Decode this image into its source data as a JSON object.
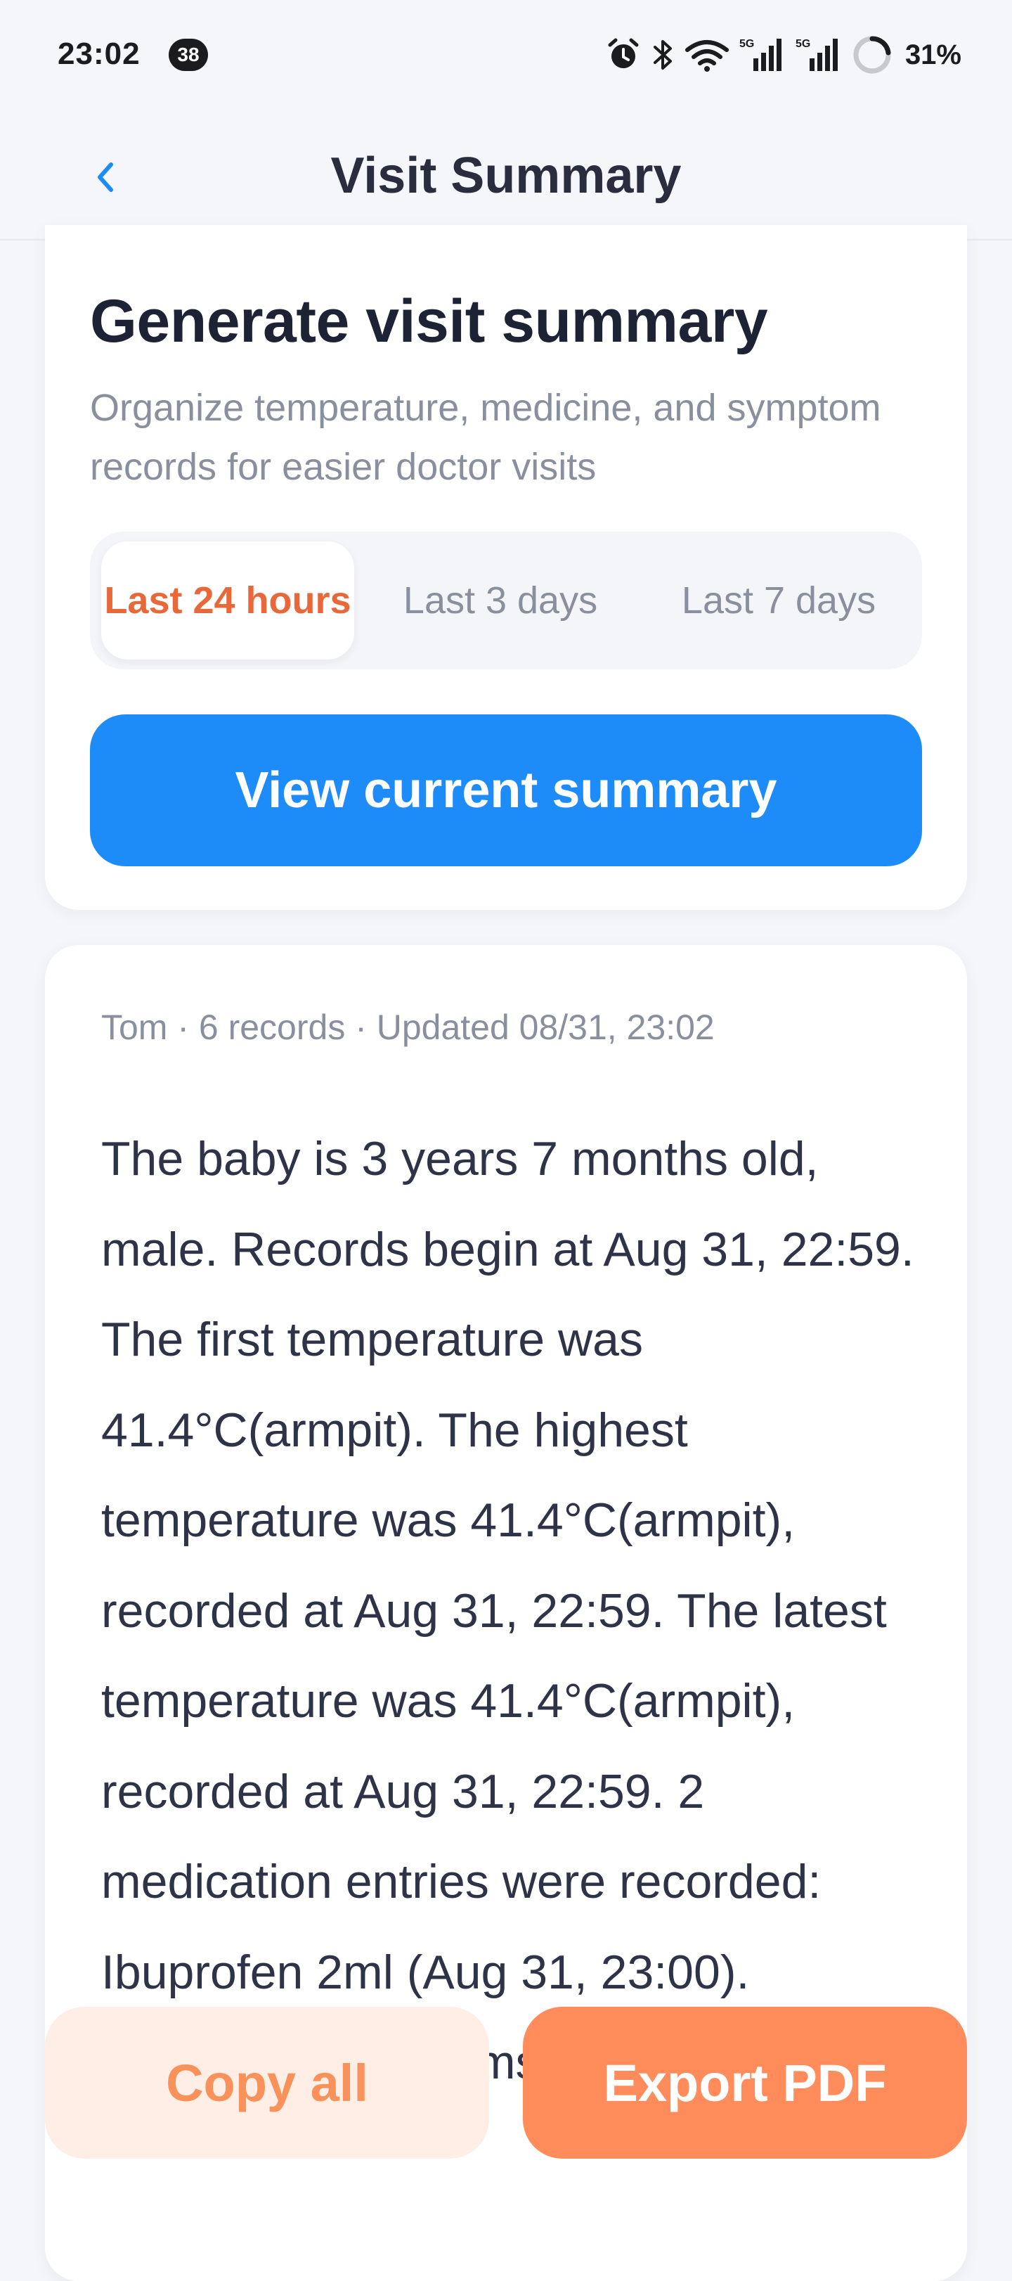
{
  "status_bar": {
    "time": "23:02",
    "notification_count": "38",
    "battery_percent": "31%",
    "icons": [
      "alarm-icon",
      "bluetooth-icon",
      "wifi-icon",
      "cellular-5g-icon",
      "cellular-5g-icon",
      "battery-ring-icon"
    ]
  },
  "header": {
    "title": "Visit Summary",
    "back_icon": "chevron-left-icon"
  },
  "generate": {
    "title": "Generate visit summary",
    "subtitle": "Organize temperature, medicine, and symptom records for easier doctor visits",
    "ranges": [
      {
        "label": "Last 24 hours",
        "selected": true
      },
      {
        "label": "Last 3 days",
        "selected": false
      },
      {
        "label": "Last 7 days",
        "selected": false
      }
    ],
    "view_button": "View current summary"
  },
  "summary": {
    "meta": "Tom · 6 records · Updated 08/31, 23:02",
    "text": "The baby is 3 years 7 months old, male. Records begin at Aug 31, 22:59. The first temperature was 41.4°C(armpit). The highest temperature was 41.4°C(armpit), recorded at Aug 31, 22:59. The latest temperature was 41.4°C(armpit), recorded at Aug 31, 22:59. 2 medication entries were recorded: Ibuprofen 2ml (Aug 31, 23:00). Recorded symptoms"
  },
  "actions": {
    "copy_all": "Copy all",
    "export_pdf": "Export PDF"
  },
  "colors": {
    "primary_blue": "#1e8cf8",
    "accent_orange": "#ff8c5a",
    "active_tab_text": "#e8683a",
    "copy_button_bg": "#feeee6"
  }
}
